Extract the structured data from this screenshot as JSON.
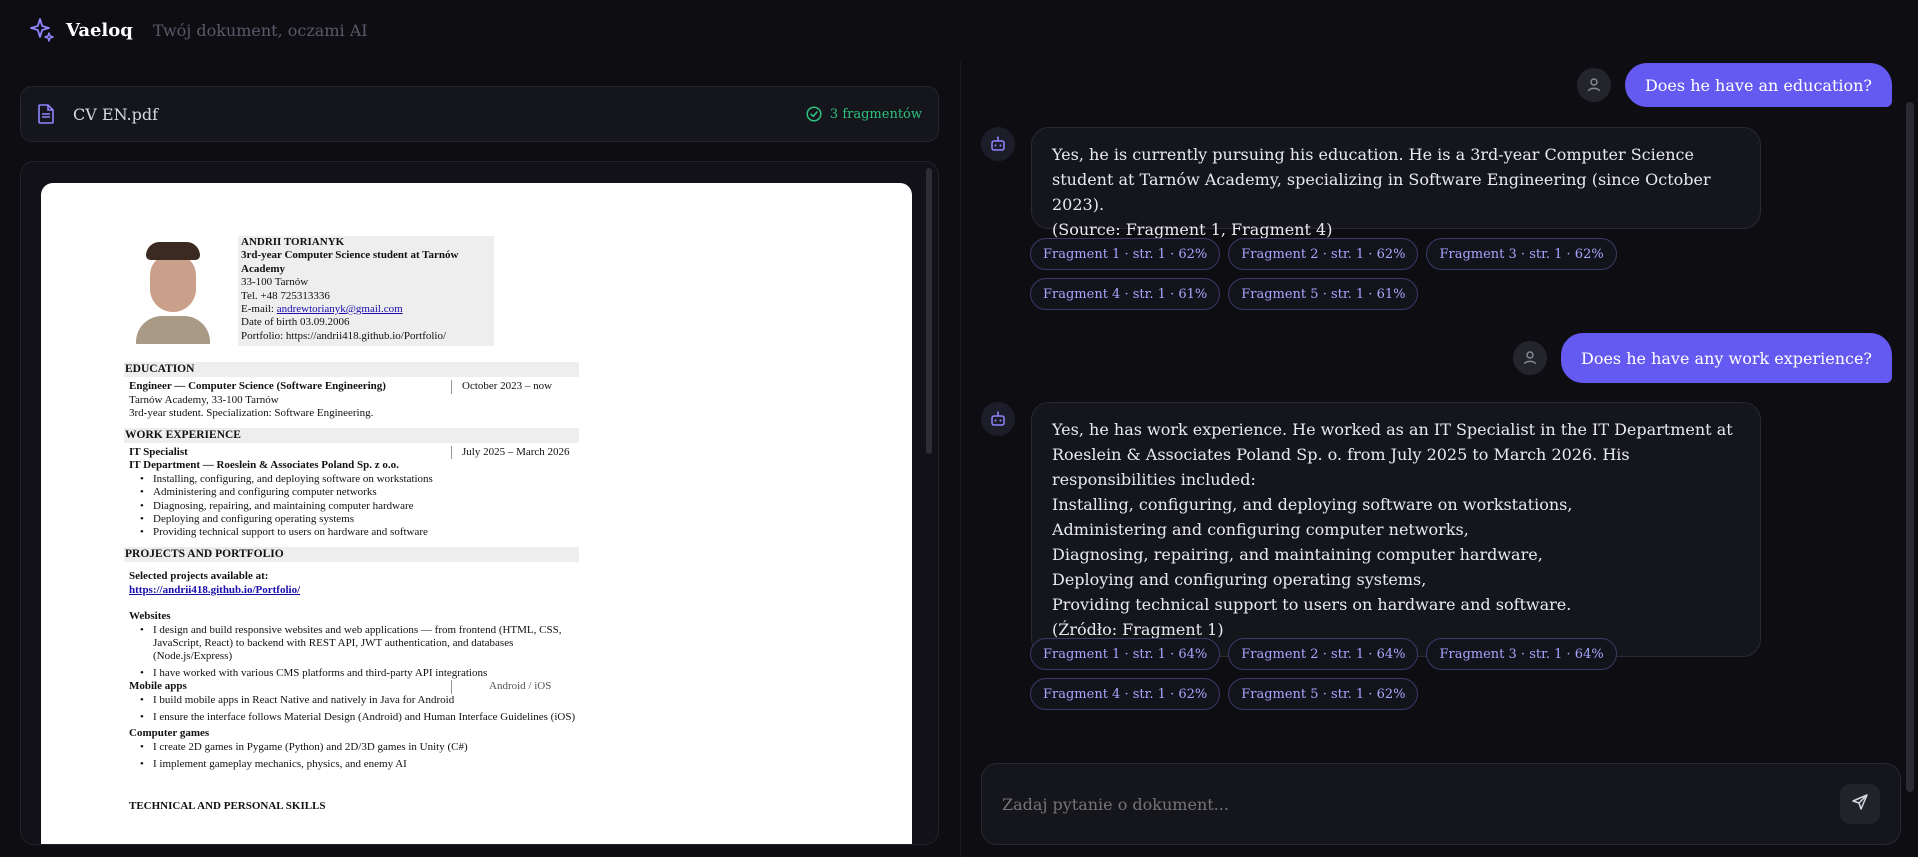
{
  "header": {
    "brand": "Vaeloq",
    "tagline": "Twój dokument, oczami AI"
  },
  "file": {
    "name": "CV EN.pdf",
    "fragments": "3 fragmentów"
  },
  "cv": {
    "name": "ANDRII TORIANYK",
    "subtitle": "3rd-year Computer Science student at Tarnów Academy",
    "city": "33-100 Tarnów",
    "tel": "Tel. +48 725313336",
    "email_label": "E-mail: ",
    "email": "andrewtorianyk@gmail.com",
    "dob": "Date of birth  03.09.2006",
    "portfolio": "Portfolio: https://andrii418.github.io/Portfolio/",
    "education_title": "EDUCATION",
    "edu_degree": "Engineer — Computer Science (Software Engineering)",
    "edu_dates": "October 2023 – now",
    "edu_school": "Tarnów Academy, 33-100 Tarnów",
    "edu_note": "3rd-year student. Specialization: Software Engineering.",
    "work_title": "WORK EXPERIENCE",
    "job_title": "IT Specialist",
    "job_dates": "July 2025 – March 2026",
    "job_company": "IT Department — Roeslein & Associates Poland Sp. z o.o.",
    "job_items": [
      "Installing, configuring, and deploying software on workstations",
      "Administering and configuring computer networks",
      "Diagnosing, repairing, and maintaining computer hardware",
      "Deploying and configuring operating systems",
      "Providing technical support to users on hardware and software"
    ],
    "projects_title": "PROJECTS AND PORTFOLIO",
    "projects_intro": "Selected projects available at:",
    "projects_link": "https://andrii418.github.io/Portfolio/",
    "websites_title": "Websites",
    "websites_items": [
      "I design and build responsive websites and web applications — from frontend (HTML, CSS, JavaScript, React) to backend with REST API, JWT authentication, and databases (Node.js/Express)",
      "I have worked with various CMS platforms and third-party API integrations"
    ],
    "mobile_title": "Mobile apps",
    "mobile_platform": "Android / iOS",
    "mobile_items": [
      "I build mobile apps in React Native and natively in Java for Android",
      "I ensure the interface follows Material Design (Android) and Human Interface Guidelines (iOS)"
    ],
    "games_title": "Computer games",
    "games_items": [
      "I create 2D games in Pygame (Python) and 2D/3D games in Unity (C#)",
      "I implement gameplay mechanics, physics, and enemy AI"
    ],
    "skills_title": "TECHNICAL AND PERSONAL SKILLS"
  },
  "chat": {
    "q1": "Does he have an education?",
    "a1": [
      "Yes, he is currently pursuing his education. He is a 3rd-year Computer Science student at Tarnów Academy, specializing in Software Engineering (since October 2023).",
      "(Source: Fragment 1, Fragment 4)"
    ],
    "chips1": [
      "Fragment 1 · str. 1 · 62%",
      "Fragment 2 · str. 1 · 62%",
      "Fragment 3 · str. 1 · 62%",
      "Fragment 4 · str. 1 · 61%",
      "Fragment 5 · str. 1 · 61%"
    ],
    "q2": "Does he have any work experience?",
    "a2": [
      "Yes, he has work experience. He worked as an IT Specialist in the IT Department at Roeslein & Associates Poland Sp. o. from July 2025 to March 2026. His responsibilities included:",
      "Installing, configuring, and deploying software on workstations,",
      "Administering and configuring computer networks,",
      "Diagnosing, repairing, and maintaining computer hardware,",
      "Deploying and configuring operating systems,",
      "Providing technical support to users on hardware and software.",
      "(Źródło: Fragment 1)"
    ],
    "chips2": [
      "Fragment 1 · str. 1 · 64%",
      "Fragment 2 · str. 1 · 64%",
      "Fragment 3 · str. 1 · 64%",
      "Fragment 4 · str. 1 · 62%",
      "Fragment 5 · str. 1 · 62%"
    ],
    "input_placeholder": "Zadaj pytanie o dokument..."
  },
  "colors": {
    "accent": "#6459f0",
    "success": "#2ec27e",
    "chip_text": "#a6a6ff",
    "background": "#0d0d12"
  },
  "icons": {
    "logo": "sparkle-icon",
    "file": "document-icon",
    "status": "check-circle-icon",
    "user": "user-icon",
    "bot": "robot-icon",
    "send": "send-icon"
  }
}
